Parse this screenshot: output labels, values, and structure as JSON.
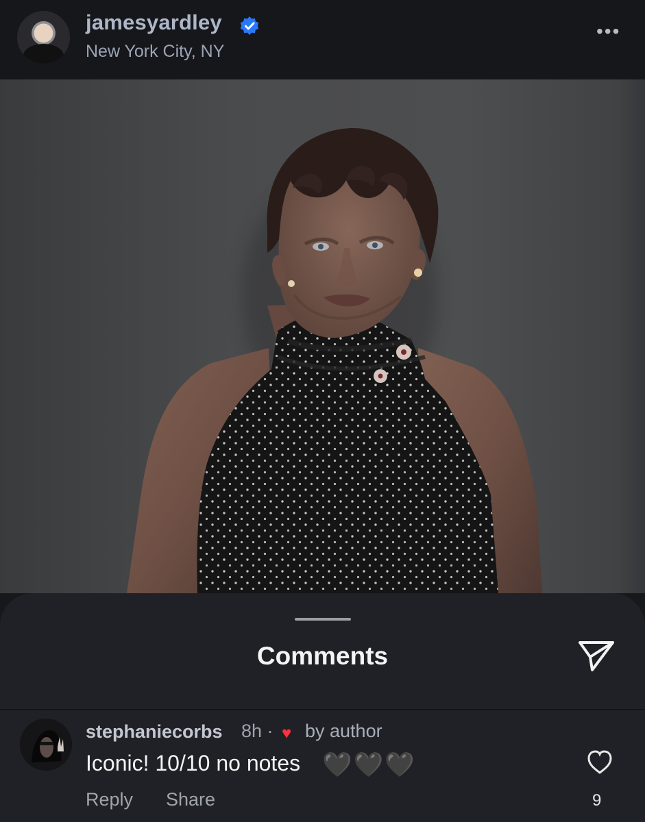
{
  "post": {
    "username": "jamesyardley",
    "location": "New York City, NY",
    "verified_icon": "verified-badge-icon",
    "more_label": "•••",
    "colors": {
      "verified_blue": "#2b78f6",
      "background": "#17181c"
    }
  },
  "comments_panel": {
    "title": "Comments",
    "send_icon": "send-icon"
  },
  "comment": {
    "username": "stephaniecorbs",
    "time": "8h ·",
    "liked_by_label": "by author",
    "text": "Iconic! 10/10 no notes",
    "emoji": "🖤🖤🖤",
    "reply_label": "Reply",
    "share_label": "Share",
    "like_count": "9",
    "like_icon": "heart-outline-icon"
  }
}
